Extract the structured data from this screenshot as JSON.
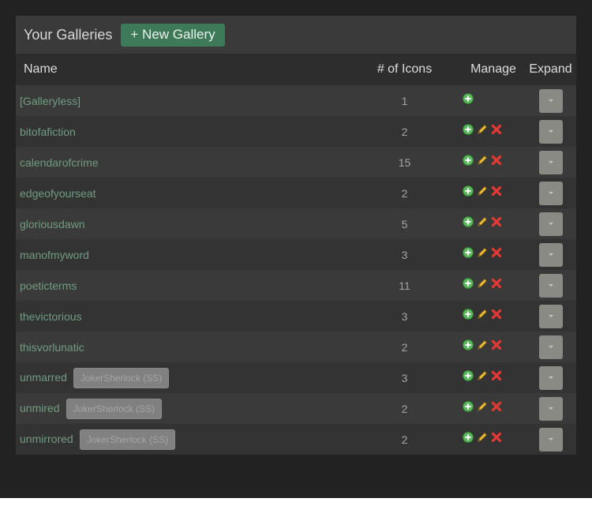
{
  "header": {
    "title": "Your Galleries",
    "new_gallery_label": "+ New Gallery"
  },
  "columns": {
    "name": "Name",
    "count": "# of Icons",
    "manage": "Manage",
    "expand": "Expand"
  },
  "icons": {
    "add": "add-icon",
    "edit": "pencil-icon",
    "delete": "delete-icon",
    "expand": "chevron-down-icon"
  },
  "colors": {
    "accent": "#3e7a5a",
    "link": "#6f9c80",
    "add": "#4caf50",
    "delete": "#e53935"
  },
  "rows": [
    {
      "name": "[Galleryless]",
      "count": "1",
      "tag": "",
      "editable": false
    },
    {
      "name": "bitofafiction",
      "count": "2",
      "tag": "",
      "editable": true
    },
    {
      "name": "calendarofcrime",
      "count": "15",
      "tag": "",
      "editable": true
    },
    {
      "name": "edgeofyourseat",
      "count": "2",
      "tag": "",
      "editable": true
    },
    {
      "name": "gloriousdawn",
      "count": "5",
      "tag": "",
      "editable": true
    },
    {
      "name": "manofmyword",
      "count": "3",
      "tag": "",
      "editable": true
    },
    {
      "name": "poeticterms",
      "count": "11",
      "tag": "",
      "editable": true
    },
    {
      "name": "thevictorious",
      "count": "3",
      "tag": "",
      "editable": true
    },
    {
      "name": "thisvorlunatic",
      "count": "2",
      "tag": "",
      "editable": true
    },
    {
      "name": "unmarred",
      "count": "3",
      "tag": "JokerSherlock (SS)",
      "editable": true
    },
    {
      "name": "unmired",
      "count": "2",
      "tag": "JokerSherlock (SS)",
      "editable": true
    },
    {
      "name": "unmirrored",
      "count": "2",
      "tag": "JokerSherlock (SS)",
      "editable": true
    }
  ]
}
